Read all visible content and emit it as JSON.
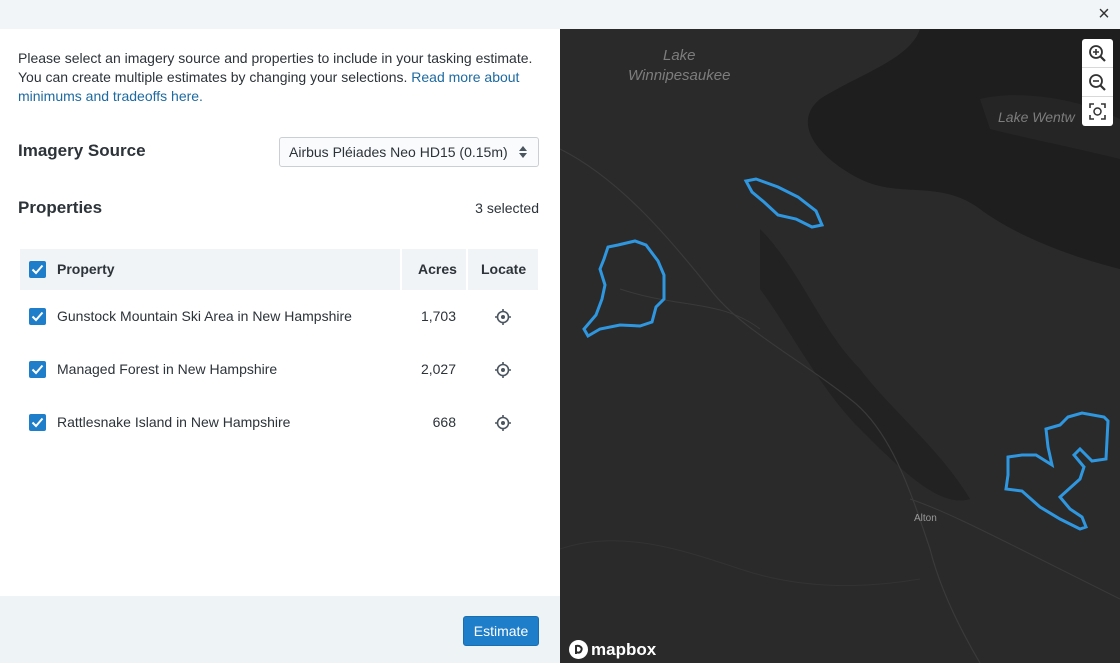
{
  "dialog": {
    "close_label": "×",
    "intro_text": "Please select an imagery source and properties to include in your tasking estimate. You can create multiple estimates by changing your selections. ",
    "intro_link": "Read more about minimums and tradeoffs here.",
    "imagery_source_label": "Imagery Source",
    "imagery_source_value": "Airbus Pléiades Neo HD15 (0.15m)",
    "properties_label": "Properties",
    "selected_count": "3 selected",
    "estimate_button": "Estimate"
  },
  "table": {
    "headers": {
      "property": "Property",
      "acres": "Acres",
      "locate": "Locate"
    },
    "rows": [
      {
        "name": "Gunstock Mountain Ski Area in New Hampshire",
        "acres": "1,703",
        "checked": true
      },
      {
        "name": "Managed Forest in New Hampshire",
        "acres": "2,027",
        "checked": true
      },
      {
        "name": "Rattlesnake Island in New Hampshire",
        "acres": "668",
        "checked": true
      }
    ]
  },
  "map": {
    "labels": {
      "lake1_line1": "Lake",
      "lake1_line2": "Winnipesaukee",
      "lake2": "Lake Wentw",
      "town": "Alton"
    },
    "attribution": "mapbox",
    "controls": {
      "zoom_in": "zoom-in-icon",
      "zoom_out": "zoom-out-icon",
      "fit": "fit-bounds-icon"
    },
    "boundary_color": "#2f97e0"
  },
  "colors": {
    "accent": "#1f7ec9",
    "link": "#1d6aa0",
    "map_bg": "#2a2a2a"
  }
}
